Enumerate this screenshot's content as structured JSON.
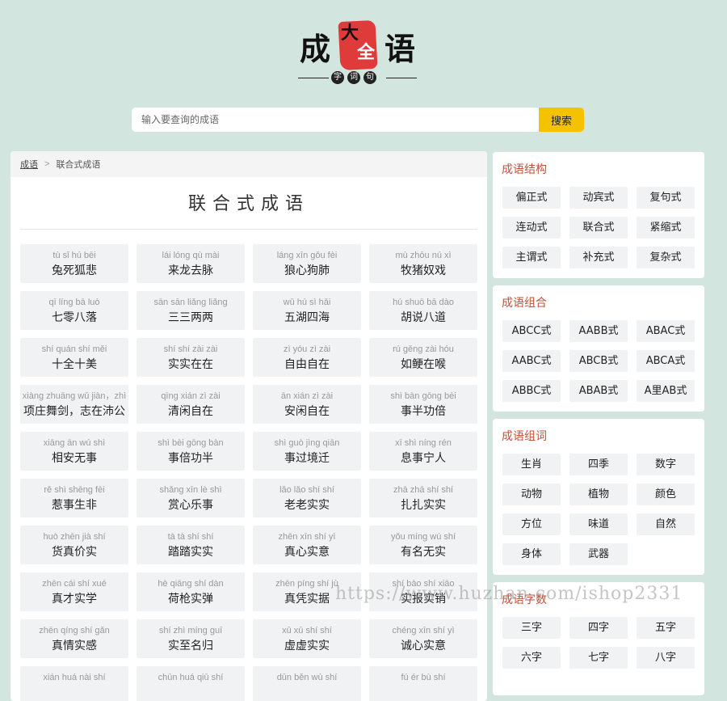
{
  "logo": {
    "left_text": "成",
    "seal_top": "大",
    "seal_bottom": "全",
    "right_text": "语",
    "sub": [
      "字",
      "词",
      "句"
    ]
  },
  "search": {
    "placeholder": "输入要查询的成语",
    "button": "搜索"
  },
  "breadcrumb": {
    "home": "成语",
    "separator": ">",
    "current": "联合式成语"
  },
  "page_title": "联合式成语",
  "idioms": [
    {
      "py": "tù sǐ hú bēi",
      "cy": "兔死狐悲"
    },
    {
      "py": "lái lóng qù mài",
      "cy": "来龙去脉"
    },
    {
      "py": "láng xīn gǒu fèi",
      "cy": "狼心狗肺"
    },
    {
      "py": "mù zhōu nú xì",
      "cy": "牧猪奴戏"
    },
    {
      "py": "qī líng bā luò",
      "cy": "七零八落"
    },
    {
      "py": "sān sān liǎng liǎng",
      "cy": "三三两两"
    },
    {
      "py": "wǔ hú sì hǎi",
      "cy": "五湖四海"
    },
    {
      "py": "hú shuō bā dào",
      "cy": "胡说八道"
    },
    {
      "py": "shí quán shí měi",
      "cy": "十全十美"
    },
    {
      "py": "shí shí zài zài",
      "cy": "实实在在"
    },
    {
      "py": "zì yóu zì zài",
      "cy": "自由自在"
    },
    {
      "py": "rú gěng zài hóu",
      "cy": "如鲠在喉"
    },
    {
      "py": "xiàng zhuāng wǔ jiàn，zhì",
      "cy": "项庄舞剑，志在沛公"
    },
    {
      "py": "qīng xián zì zài",
      "cy": "清闲自在"
    },
    {
      "py": "ān xián zì zài",
      "cy": "安闲自在"
    },
    {
      "py": "shì bàn gōng bèi",
      "cy": "事半功倍"
    },
    {
      "py": "xiāng ān wú shì",
      "cy": "相安无事"
    },
    {
      "py": "shì bèi gōng bàn",
      "cy": "事倍功半"
    },
    {
      "py": "shì guò jìng qiān",
      "cy": "事过境迁"
    },
    {
      "py": "xī shì níng rén",
      "cy": "息事宁人"
    },
    {
      "py": "rě shì shēng fēi",
      "cy": "惹事生非"
    },
    {
      "py": "shǎng xīn lè shì",
      "cy": "赏心乐事"
    },
    {
      "py": "lǎo lǎo shí shí",
      "cy": "老老实实"
    },
    {
      "py": "zhā zhā shí shí",
      "cy": "扎扎实实"
    },
    {
      "py": "huò zhēn jià shí",
      "cy": "货真价实"
    },
    {
      "py": "tà tà shí shí",
      "cy": "踏踏实实"
    },
    {
      "py": "zhēn xīn shí yì",
      "cy": "真心实意"
    },
    {
      "py": "yǒu míng wú shí",
      "cy": "有名无实"
    },
    {
      "py": "zhēn cái shí xué",
      "cy": "真才实学"
    },
    {
      "py": "hè qiāng shí dàn",
      "cy": "荷枪实弹"
    },
    {
      "py": "zhēn píng shí jù",
      "cy": "真凭实据"
    },
    {
      "py": "shí bào shí xiāo",
      "cy": "实报实销"
    },
    {
      "py": "zhēn qíng shí gǎn",
      "cy": "真情实感"
    },
    {
      "py": "shí zhì míng guī",
      "cy": "实至名归"
    },
    {
      "py": "xū xū shí shí",
      "cy": "虚虚实实"
    },
    {
      "py": "chéng xīn shí yì",
      "cy": "诚心实意"
    },
    {
      "py": "xián huá nài shí",
      "cy": ""
    },
    {
      "py": "chūn huá qiū shí",
      "cy": ""
    },
    {
      "py": "dūn běn wù shí",
      "cy": ""
    },
    {
      "py": "fú ér bù shí",
      "cy": ""
    }
  ],
  "sidebar": {
    "structure": {
      "title": "成语结构",
      "items": [
        "偏正式",
        "动宾式",
        "复句式",
        "连动式",
        "联合式",
        "紧缩式",
        "主谓式",
        "补充式",
        "复杂式"
      ]
    },
    "pattern": {
      "title": "成语组合",
      "items": [
        "ABCC式",
        "AABB式",
        "ABAC式",
        "AABC式",
        "ABCB式",
        "ABCA式",
        "ABBC式",
        "ABAB式",
        "A里AB式"
      ]
    },
    "words": {
      "title": "成语组词",
      "items": [
        "生肖",
        "四季",
        "数字",
        "动物",
        "植物",
        "颜色",
        "方位",
        "味道",
        "自然",
        "身体",
        "武器"
      ]
    },
    "count": {
      "title": "成语字数",
      "items": [
        "三字",
        "四字",
        "五字",
        "六字",
        "七字",
        "八字"
      ]
    }
  },
  "watermark": "https://www.huzhan.com/ishop2331"
}
